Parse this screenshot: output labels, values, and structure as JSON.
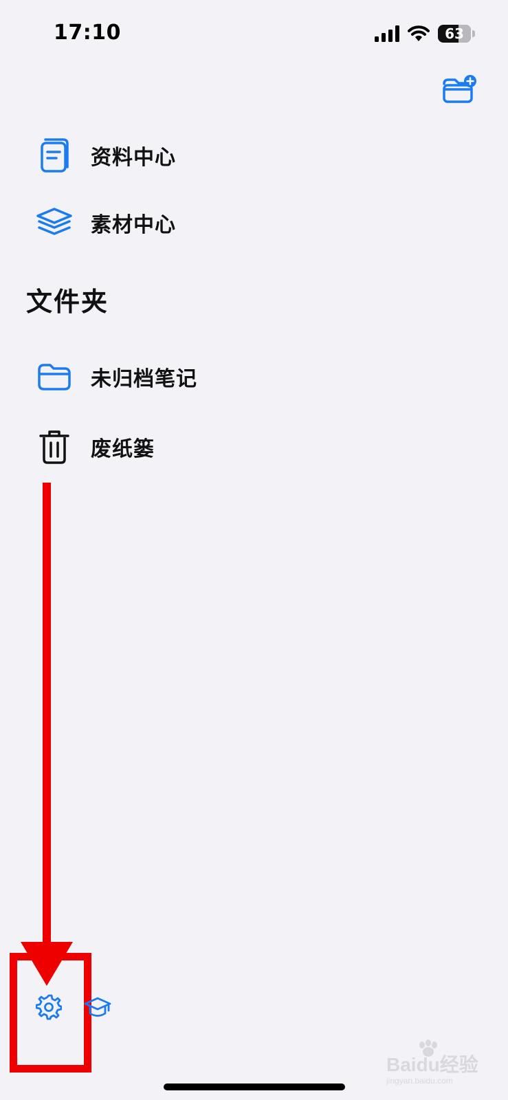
{
  "status_bar": {
    "time": "17:10",
    "battery_level": "63",
    "battery_fraction": 0.63
  },
  "toolbar": {
    "new_folder_icon": "folder-plus-icon"
  },
  "library": {
    "items": [
      {
        "label": "资料中心",
        "icon": "document-icon"
      },
      {
        "label": "素材中心",
        "icon": "layers-icon"
      }
    ]
  },
  "folders": {
    "title": "文件夹",
    "items": [
      {
        "label": "未归档笔记",
        "icon": "folder-icon"
      },
      {
        "label": "废纸篓",
        "icon": "trash-icon"
      }
    ]
  },
  "bottom_bar": {
    "settings_icon": "gear-icon",
    "learn_icon": "graduation-cap-icon"
  },
  "colors": {
    "accent": "#1a7cf0",
    "background": "#f2f2f7",
    "annotation": "#ee0000"
  },
  "watermark": {
    "text": "Baidu经验",
    "subtext": "jingyan.baidu.com"
  }
}
